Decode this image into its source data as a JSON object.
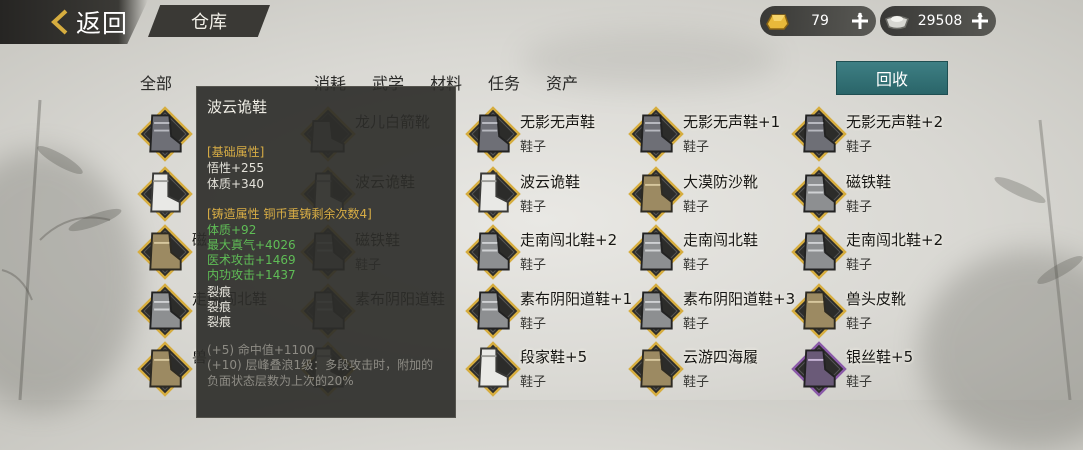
{
  "header": {
    "back_label": "返回",
    "title": "仓库"
  },
  "currency": {
    "gold": {
      "value": "79",
      "icon": "gold-ingot-icon"
    },
    "silver": {
      "value": "29508",
      "icon": "silver-ingot-icon"
    }
  },
  "tabs": [
    {
      "label": "全部",
      "selected": false
    },
    {
      "label": "",
      "selected": false
    },
    {
      "label": "",
      "selected": true
    },
    {
      "label": "消耗",
      "selected": false
    },
    {
      "label": "武学",
      "selected": false
    },
    {
      "label": "材料",
      "selected": false
    },
    {
      "label": "任务",
      "selected": false
    },
    {
      "label": "资产",
      "selected": false
    }
  ],
  "recycle_label": "回收",
  "items": [
    {
      "name": "",
      "type": "",
      "icon": "armored-boot-icon"
    },
    {
      "name": "龙儿白箭靴",
      "type": "",
      "icon": "cloth-shoe-icon"
    },
    {
      "name": "无影无声鞋",
      "type": "鞋子",
      "icon": "armored-boot-icon"
    },
    {
      "name": "无影无声鞋+1",
      "type": "鞋子",
      "icon": "armored-boot-icon"
    },
    {
      "name": "无影无声鞋+2",
      "type": "鞋子",
      "icon": "armored-boot-icon"
    },
    {
      "name": "",
      "type": "",
      "icon": "white-boot-icon"
    },
    {
      "name": "波云诡鞋",
      "type": "",
      "icon": "white-boot-icon"
    },
    {
      "name": "波云诡鞋",
      "type": "鞋子",
      "icon": "white-boot-icon"
    },
    {
      "name": "大漠防沙靴",
      "type": "鞋子",
      "icon": "desert-boot-icon"
    },
    {
      "name": "磁铁鞋",
      "type": "鞋子",
      "icon": "grey-boot-icon"
    },
    {
      "name": "磁",
      "type": "",
      "icon": "desert-boot-icon"
    },
    {
      "name": "磁铁鞋",
      "type": "鞋子",
      "icon": "grey-boot-icon"
    },
    {
      "name": "走南闯北鞋+2",
      "type": "鞋子",
      "icon": "grey-boot-icon"
    },
    {
      "name": "走南闯北鞋",
      "type": "鞋子",
      "icon": "grey-boot-icon"
    },
    {
      "name": "走南闯北鞋+2",
      "type": "鞋子",
      "icon": "grey-boot-icon"
    },
    {
      "name": "走南闯北鞋",
      "type": "",
      "icon": "grey-boot-icon"
    },
    {
      "name": "素布阴阳道鞋",
      "type": "",
      "icon": "grey-boot-icon"
    },
    {
      "name": "素布阴阳道鞋+1",
      "type": "鞋子",
      "icon": "grey-boot-icon"
    },
    {
      "name": "素布阴阳道鞋+3",
      "type": "鞋子",
      "icon": "grey-boot-icon"
    },
    {
      "name": "兽头皮靴",
      "type": "鞋子",
      "icon": "desert-boot-icon"
    },
    {
      "name": "兽",
      "type": "",
      "icon": "desert-boot-icon"
    },
    {
      "name": "",
      "type": "",
      "icon": "white-boot-icon"
    },
    {
      "name": "段家鞋+5",
      "type": "鞋子",
      "icon": "white-boot-icon"
    },
    {
      "name": "云游四海履",
      "type": "鞋子",
      "icon": "desert-boot-icon"
    },
    {
      "name": "银丝鞋+5",
      "type": "鞋子",
      "icon": "purple-boot-icon"
    }
  ],
  "tooltip": {
    "title": "波云诡鞋",
    "base_header": "[基础属性]",
    "base_stats": [
      "悟性+255",
      "体质+340"
    ],
    "forge_header": "[铸造属性  铜币重铸剩余次数4]",
    "forge_stats": [
      "体质+92",
      "最大真气+4026",
      "医术攻击+1469",
      "内功攻击+1437"
    ],
    "cracks": [
      "裂痕",
      "裂痕",
      "裂痕"
    ],
    "extra_1": "(+5) 命中值+1100",
    "extra_2": "(+10) 层峰叠浪1级：多段攻击时，附加的负面状态层数为上次的20%"
  },
  "colors": {
    "accent_teal": "#2a6569",
    "rarity_gold": "#d6ad3f",
    "rarity_purple": "#8a5aa8",
    "stat_green": "#5fbd56",
    "stat_gold": "#d8ad45"
  }
}
